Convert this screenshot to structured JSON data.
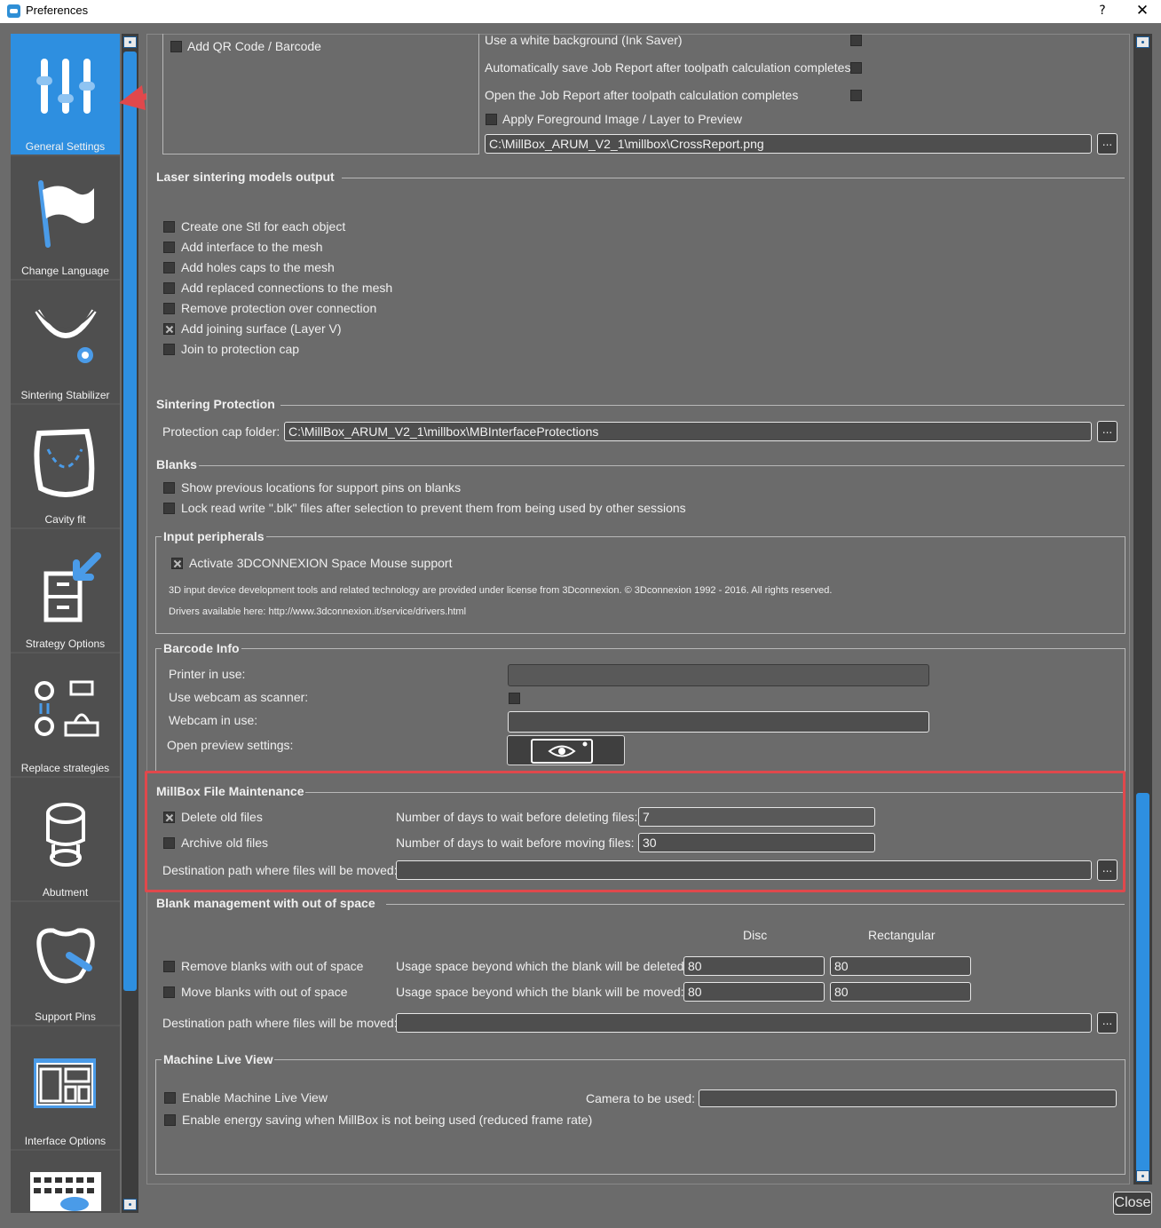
{
  "window": {
    "title": "Preferences",
    "help_glyph": "?",
    "close_glyph": "✕"
  },
  "sidebar": {
    "items": [
      {
        "label": "General Settings",
        "icon": "sliders-icon",
        "active": true
      },
      {
        "label": "Change Language",
        "icon": "flag-icon"
      },
      {
        "label": "Sintering Stabilizer",
        "icon": "dental-arch-gear-icon"
      },
      {
        "label": "Cavity fit",
        "icon": "tooth-cavity-icon"
      },
      {
        "label": "Strategy Options",
        "icon": "cabinet-arrow-icon"
      },
      {
        "label": "Replace strategies",
        "icon": "tool-swap-icon"
      },
      {
        "label": "Abutment",
        "icon": "abutment-icon"
      },
      {
        "label": "Support Pins",
        "icon": "tooth-pin-icon"
      },
      {
        "label": "Interface Options",
        "icon": "layout-icon"
      },
      {
        "label": "",
        "icon": "keyboard-icon"
      }
    ]
  },
  "report": {
    "add_qr": "Add QR Code / Barcode",
    "white_bg": "Use a white background (Ink Saver)",
    "auto_save": "Automatically save Job Report after toolpath calculation completes",
    "open_report": "Open the Job Report after toolpath calculation completes",
    "apply_fg": "Apply Foreground Image / Layer to Preview",
    "fg_path": "C:\\MillBox_ARUM_V2_1\\millbox\\CrossReport.png",
    "browse": "..."
  },
  "laser": {
    "title": "Laser sintering models output",
    "options": [
      {
        "label": "Create one Stl for each object",
        "checked": false
      },
      {
        "label": "Add interface to the mesh",
        "checked": false
      },
      {
        "label": "Add holes caps to the mesh",
        "checked": false
      },
      {
        "label": "Add replaced connections to the mesh",
        "checked": false
      },
      {
        "label": "Remove protection over connection",
        "checked": false
      },
      {
        "label": "Add joining surface (Layer V)",
        "checked": true
      },
      {
        "label": "Join to protection cap",
        "checked": false
      }
    ]
  },
  "sintering": {
    "title": "Sintering Protection",
    "folder_label": "Protection cap folder:",
    "folder_value": "C:\\MillBox_ARUM_V2_1\\millbox\\MBInterfaceProtections"
  },
  "blanks": {
    "title": "Blanks",
    "show_prev": "Show previous locations for support pins on blanks",
    "lock_read": "Lock read write \".blk\" files after selection to prevent them from being used by other sessions"
  },
  "input": {
    "title": "Input peripherals",
    "activate": "Activate 3DCONNEXION Space Mouse support",
    "license": "3D input device development tools and related technology are provided under license from 3Dconnexion. © 3Dconnexion 1992 - 2016. All rights reserved.",
    "drivers": "Drivers available here: http://www.3dconnexion.it/service/drivers.html"
  },
  "barcode": {
    "title": "Barcode Info",
    "printer": "Printer in use:",
    "webcam_scanner": "Use webcam as scanner:",
    "webcam_in_use": "Webcam in use:",
    "preview": "Open preview settings:"
  },
  "maintenance": {
    "title": "MillBox File Maintenance",
    "delete": "Delete old files",
    "delete_days_label": "Number of days to wait before deleting files:",
    "delete_days": "7",
    "archive": "Archive old files",
    "move_days_label": "Number of days to wait before moving files:",
    "move_days": "30",
    "dest_label": "Destination path where files will be moved:"
  },
  "blank_mgmt": {
    "title": "Blank management with out of space",
    "disc": "Disc",
    "rect": "Rectangular",
    "remove": "Remove blanks with out of space",
    "remove_label": "Usage space beyond which the blank will be deleted:",
    "remove_disc": "80",
    "remove_rect": "80",
    "move": "Move blanks with out of space",
    "move_label": "Usage space beyond which the blank will be moved:",
    "move_disc": "80",
    "move_rect": "80",
    "dest_label": "Destination path where files will be moved:"
  },
  "live_view": {
    "title": "Machine Live View",
    "enable": "Enable Machine Live View",
    "camera": "Camera to be used:",
    "energy": "Enable energy saving when MillBox is not being used (reduced frame rate)"
  },
  "footer": {
    "close": "Close"
  },
  "colors": {
    "accent": "#2e8fe0",
    "highlight": "#e0484c",
    "panel": "#6b6b6b"
  }
}
